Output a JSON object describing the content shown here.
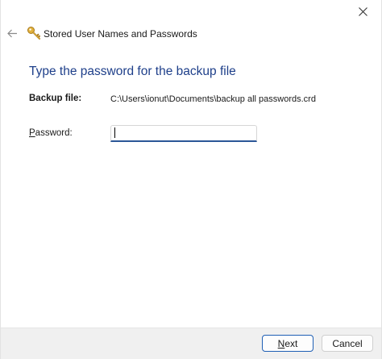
{
  "window": {
    "title": "Stored User Names and Passwords",
    "icon": "key-icon"
  },
  "main": {
    "heading": "Type the password for the backup file",
    "backup_label": "Backup file:",
    "backup_path": "C:\\Users\\ionut\\Documents\\backup all passwords.crd",
    "password_label_mnemonic": "P",
    "password_label_rest": "assword:",
    "password_value": ""
  },
  "footer": {
    "next_mnemonic": "N",
    "next_rest": "ext",
    "cancel_label": "Cancel"
  },
  "colors": {
    "heading": "#1e3f8a",
    "accent": "#2b5797",
    "footer_bg": "#f0f0f0"
  }
}
